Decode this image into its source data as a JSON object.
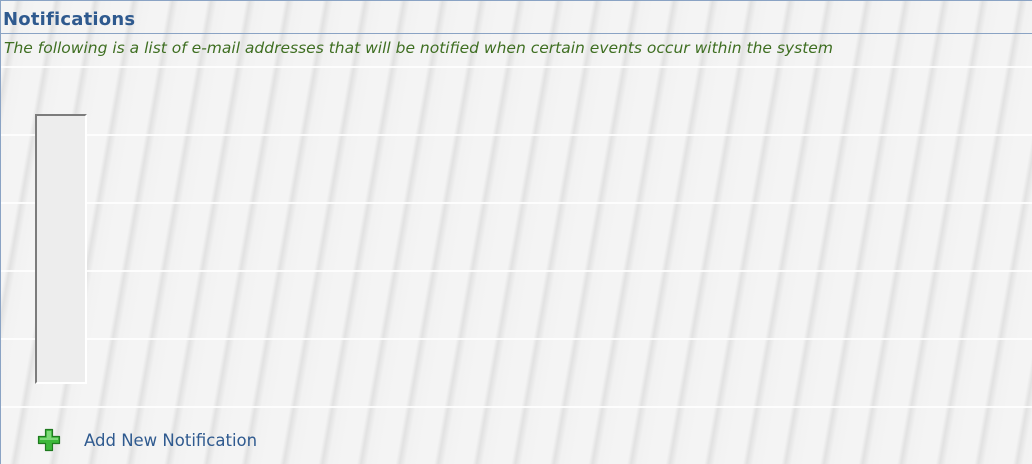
{
  "section": {
    "title": "Notifications",
    "description": "The following is a list of e-mail addresses that will be notified when certain events occur within the system"
  },
  "email_list": {
    "items": []
  },
  "actions": {
    "add_label": "Add New Notification",
    "add_icon": "plus-icon"
  },
  "colors": {
    "title": "#2f5a8f",
    "description": "#3f6f22",
    "link": "#2f5a8f",
    "icon": "#3cb83a"
  }
}
